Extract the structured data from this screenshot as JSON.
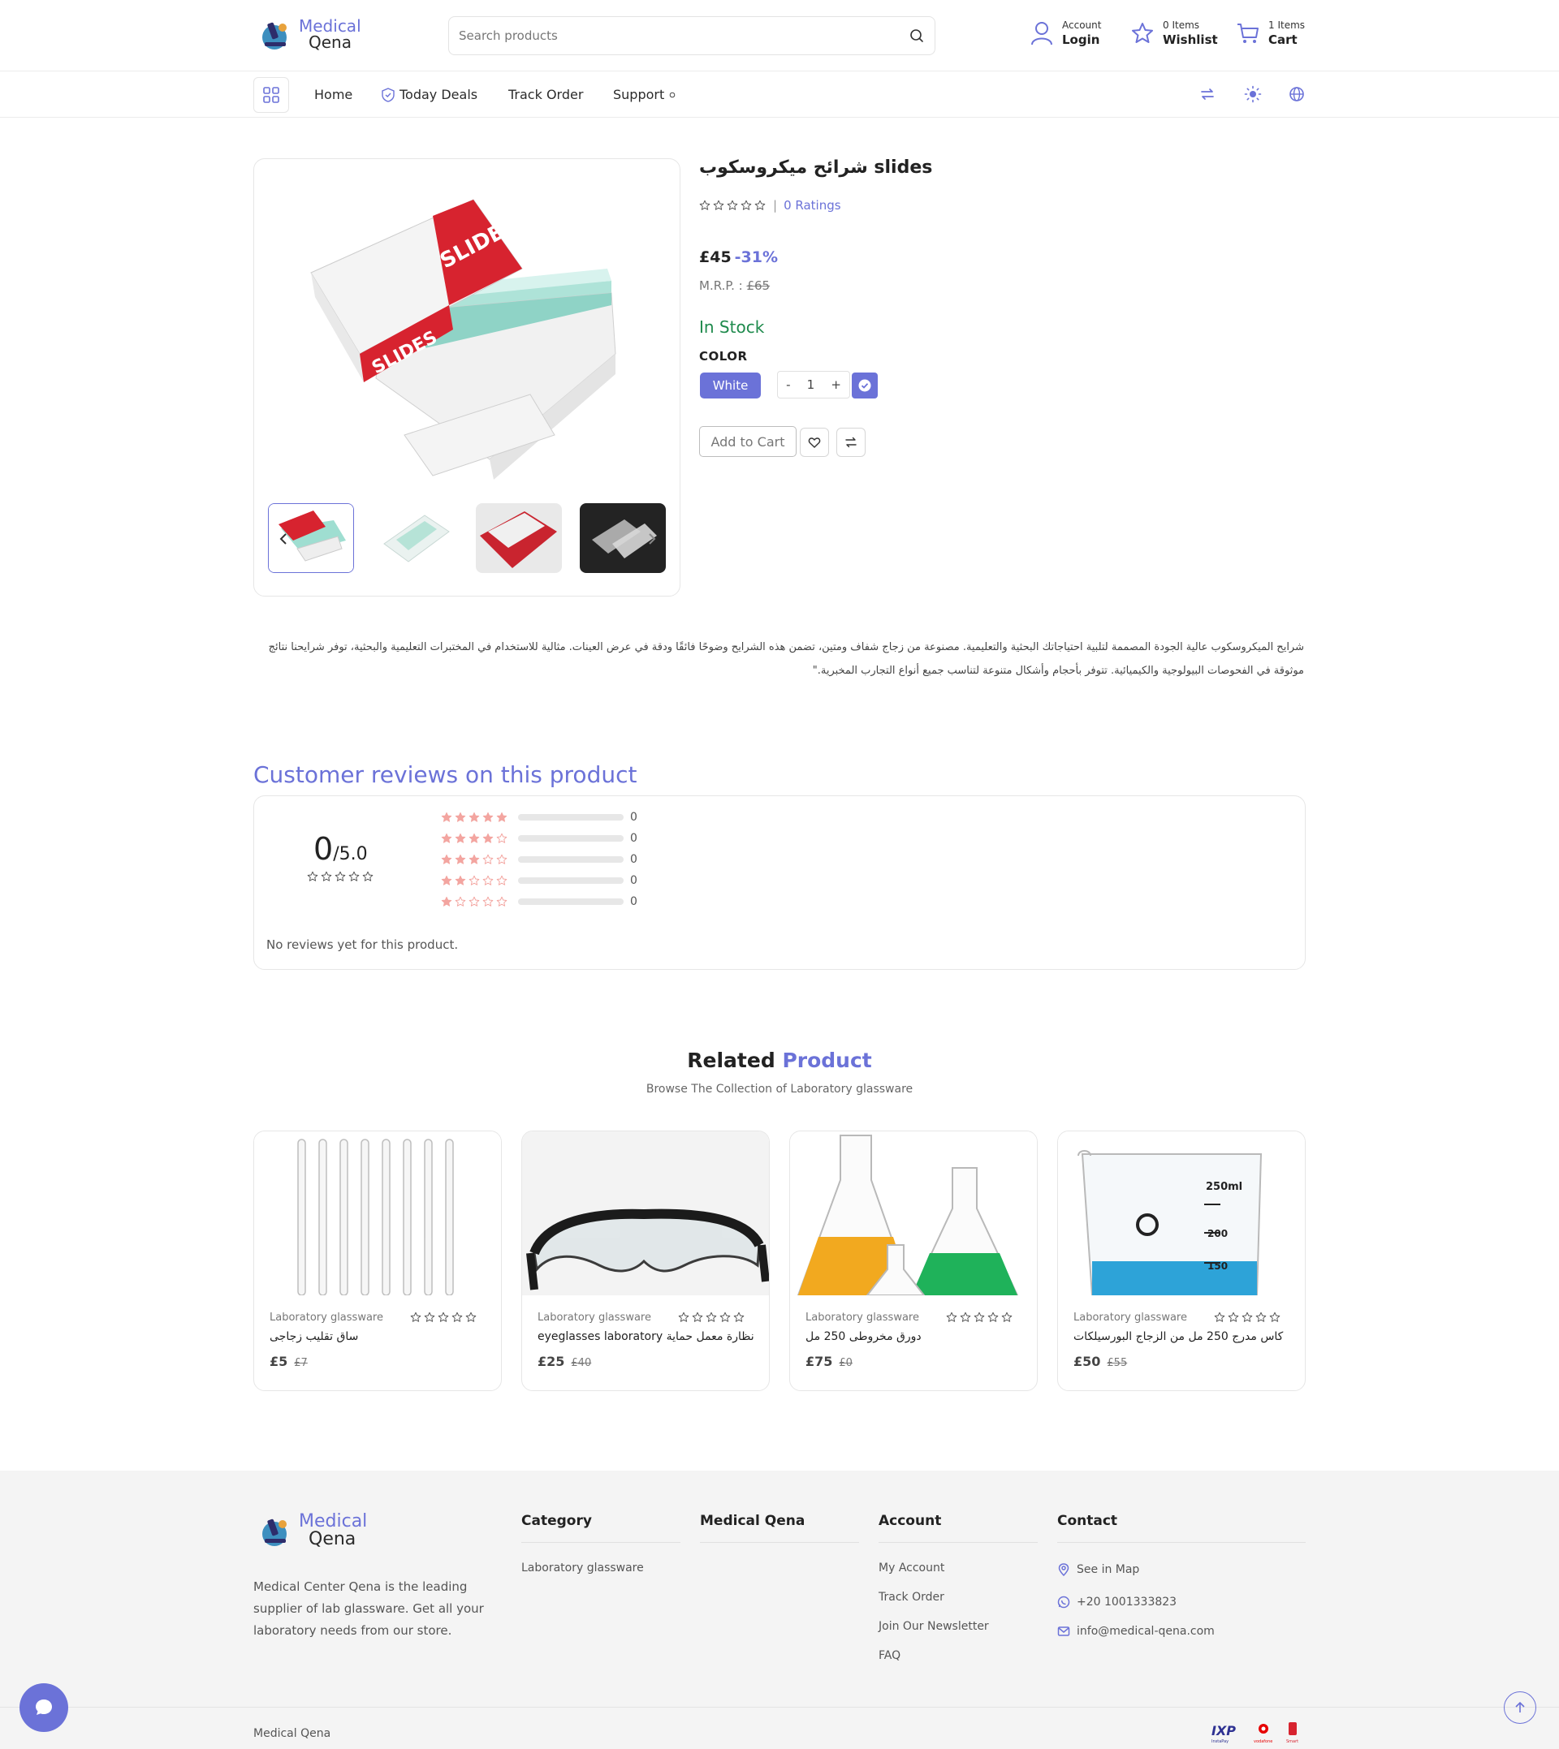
{
  "header": {
    "logo": {
      "line1": "Medical",
      "line2": "Qena"
    },
    "search_placeholder": "Search products",
    "account": {
      "small": "Account",
      "big": "Login"
    },
    "wishlist": {
      "small": "0 Items",
      "big": "Wishlist"
    },
    "cart": {
      "small": "1 Items",
      "big": "Cart"
    }
  },
  "nav": {
    "items": [
      "Home",
      "Today Deals",
      "Track Order",
      "Support"
    ]
  },
  "product": {
    "title": "شرائح ميكروسكوب slides",
    "ratings": "0 Ratings",
    "rating_value": 0,
    "price": "£45",
    "discount": "-31%",
    "mrp_label": "M.R.P. :",
    "mrp_value": "£65",
    "stock": "In Stock",
    "color_label": "COLOR",
    "color_value": "White",
    "qty_minus": "-",
    "qty_value": "1",
    "qty_plus": "+",
    "add_to_cart": "Add to Cart",
    "description": "شرايح الميكروسكوب عالية الجودة المصممة لتلبية احتياجاتك البحثية والتعليمية. مصنوعة من زجاج شفاف ومتين، تضمن هذه الشرايح وضوحًا فائقًا ودقة في عرض العينات. مثالية للاستخدام في المختبرات التعليمية والبحثية، توفر شرايحنا نتائج موثوقة في الفحوصات البيولوجية والكيميائية. تتوفر بأحجام وأشكال متنوعة لتناسب جميع أنواع التجارب المخبرية.\""
  },
  "reviews": {
    "title": "Customer reviews on this product",
    "score": "0",
    "score_max": "/5.0",
    "bars": [
      {
        "stars": 5,
        "count": "0",
        "fill": 0
      },
      {
        "stars": 4,
        "count": "0",
        "fill": 0
      },
      {
        "stars": 3,
        "count": "0",
        "fill": 0
      },
      {
        "stars": 2,
        "count": "0",
        "fill": 0
      },
      {
        "stars": 1,
        "count": "0",
        "fill": 0
      }
    ],
    "empty_text": "No reviews yet for this product."
  },
  "related": {
    "title_plain": "Related",
    "title_accent": "Product",
    "subtitle": "Browse The Collection of Laboratory glassware",
    "cards": [
      {
        "category": "Laboratory glassware",
        "name": "ساق تقليب زجاجى",
        "price": "£5",
        "old": "£7",
        "image": "glass-stirring-rods"
      },
      {
        "category": "Laboratory glassware",
        "name": "نظارة معمل حماية eyeglasses laboratory",
        "price": "£25",
        "old": "£40",
        "image": "safety-glasses"
      },
      {
        "category": "Laboratory glassware",
        "name": "دورق مخروطى 250 مل",
        "price": "£75",
        "old": "£0",
        "image": "conical-flasks"
      },
      {
        "category": "Laboratory glassware",
        "name": "كاس مدرج 250 مل من الزجاج البورسيلكات",
        "price": "£50",
        "old": "£55",
        "image": "graduated-beaker"
      }
    ]
  },
  "footer": {
    "description": "Medical Center Qena is the leading supplier of lab glassware. Get all your laboratory needs from our store.",
    "category_title": "Category",
    "category_links": [
      "Laboratory glassware"
    ],
    "brand_title": "Medical Qena",
    "account_title": "Account",
    "account_links": [
      "My Account",
      "Track Order",
      "Join Our Newsletter",
      "FAQ"
    ],
    "contact_title": "Contact",
    "contact": {
      "map": "See in Map",
      "phone": "+20 1001333823",
      "email": "info@medical-qena.com"
    },
    "copyright": "Medical Qena",
    "payment_logos": [
      "InstaPay",
      "vodafone",
      "Smart"
    ]
  },
  "colors": {
    "accent": "#6b72d8",
    "stock_green": "#1e8a4c",
    "star_pink": "#f3a5a0",
    "footer_bg": "#f4f4f4"
  }
}
